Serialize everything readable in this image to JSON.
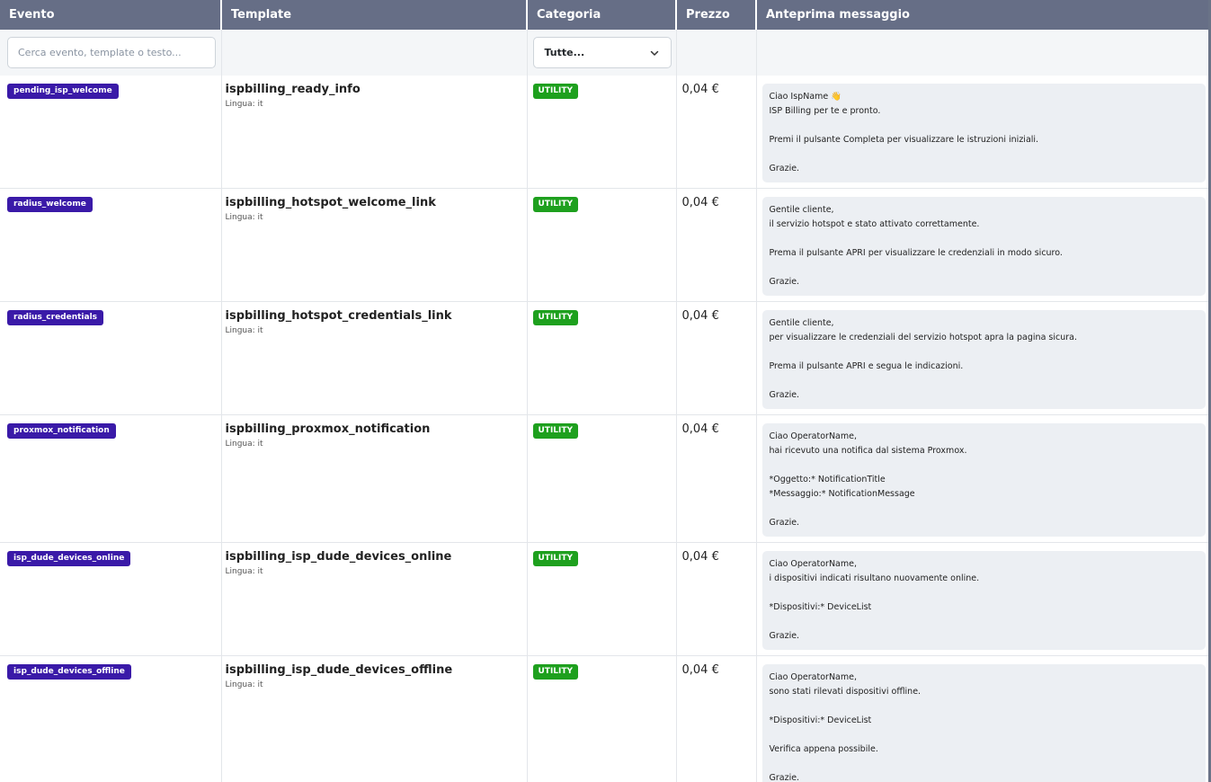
{
  "header": {
    "col_event": "Evento",
    "col_template": "Template",
    "col_category": "Categoria",
    "col_price": "Prezzo",
    "col_preview": "Anteprima messaggio"
  },
  "filters": {
    "search_placeholder": "Cerca evento, template o testo...",
    "category_selected": "Tutte..."
  },
  "rows": [
    {
      "event": "pending_isp_welcome",
      "template": "ispbilling_ready_info",
      "language": "Lingua: it",
      "category": "UTILITY",
      "price": "0,04 €",
      "message": [
        "Ciao IspName 👋",
        "ISP Billing per te e pronto.",
        "",
        "Premi il pulsante Completa per visualizzare le istruzioni iniziali.",
        "",
        "Grazie."
      ]
    },
    {
      "event": "radius_welcome",
      "template": "ispbilling_hotspot_welcome_link",
      "language": "Lingua: it",
      "category": "UTILITY",
      "price": "0,04 €",
      "message": [
        "Gentile cliente,",
        "il servizio hotspot e stato attivato correttamente.",
        "",
        "Prema il pulsante APRI per visualizzare le credenziali in modo sicuro.",
        "",
        "Grazie."
      ]
    },
    {
      "event": "radius_credentials",
      "template": "ispbilling_hotspot_credentials_link",
      "language": "Lingua: it",
      "category": "UTILITY",
      "price": "0,04 €",
      "message": [
        "Gentile cliente,",
        "per visualizzare le credenziali del servizio hotspot apra la pagina sicura.",
        "",
        "Prema il pulsante APRI e segua le indicazioni.",
        "",
        "Grazie."
      ]
    },
    {
      "event": "proxmox_notification",
      "template": "ispbilling_proxmox_notification",
      "language": "Lingua: it",
      "category": "UTILITY",
      "price": "0,04 €",
      "message": [
        "Ciao OperatorName,",
        "hai ricevuto una notifica dal sistema Proxmox.",
        "",
        "*Oggetto:* NotificationTitle",
        "*Messaggio:* NotificationMessage",
        "",
        "Grazie."
      ]
    },
    {
      "event": "isp_dude_devices_online",
      "template": "ispbilling_isp_dude_devices_online",
      "language": "Lingua: it",
      "category": "UTILITY",
      "price": "0,04 €",
      "message": [
        "Ciao OperatorName,",
        "i dispositivi indicati risultano nuovamente online.",
        "",
        "*Dispositivi:* DeviceList",
        "",
        "Grazie."
      ]
    },
    {
      "event": "isp_dude_devices_offline",
      "template": "ispbilling_isp_dude_devices_offline",
      "language": "Lingua: it",
      "category": "UTILITY",
      "price": "0,04 €",
      "message": [
        "Ciao OperatorName,",
        "sono stati rilevati dispositivi offline.",
        "",
        "*Dispositivi:* DeviceList",
        "",
        "Verifica appena possibile.",
        "",
        "Grazie."
      ]
    }
  ]
}
